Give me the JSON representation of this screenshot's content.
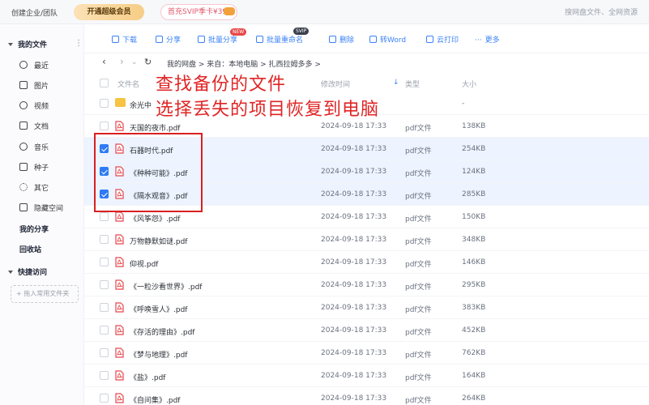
{
  "topbar": {
    "org": "创建企业/团队",
    "vip_button": "开通超级会员",
    "promo": "首充SVIP季卡¥39!",
    "search_placeholder": "搜网盘文件、全网资源"
  },
  "sidebar": {
    "my_files": "我的文件",
    "items": [
      {
        "label": "最近",
        "icon": "clock-icon"
      },
      {
        "label": "图片",
        "icon": "image-icon"
      },
      {
        "label": "视频",
        "icon": "video-icon"
      },
      {
        "label": "文档",
        "icon": "document-icon"
      },
      {
        "label": "音乐",
        "icon": "music-icon"
      },
      {
        "label": "种子",
        "icon": "bt-icon"
      },
      {
        "label": "其它",
        "icon": "more-icon"
      },
      {
        "label": "隐藏空间",
        "icon": "lock-icon"
      }
    ],
    "my_share": "我的分享",
    "recycle": "回收站",
    "quick_access": "快捷访问",
    "add_folder": "+ 拖入常用文件夹"
  },
  "toolbar": {
    "download": "下载",
    "share": "分享",
    "batch_share": "批量分享",
    "batch_share_badge": "NEW",
    "batch_rename": "批量重命名",
    "batch_rename_badge": "SVIP",
    "delete": "删除",
    "to_word": "转Word",
    "cloud_print": "云打印",
    "more": "更多"
  },
  "breadcrumb": {
    "path": "我的网盘  >  来自：本地电脑  >  扎西拉姆多多  >"
  },
  "columns": {
    "name": "文件名",
    "modified": "修改时间",
    "type": "类型",
    "size": "大小"
  },
  "annotations": {
    "line1": "查找备份的文件",
    "line2": "选择丢失的项目恢复到电脑"
  },
  "files": [
    {
      "name": "余光中",
      "date": "",
      "type": "",
      "size": "-",
      "kind": "folder",
      "checked": false
    },
    {
      "name": "天国的夜市.pdf",
      "date": "2024-09-18 17:33",
      "type": "pdf文件",
      "size": "138KB",
      "kind": "pdf",
      "checked": false
    },
    {
      "name": "石器时代.pdf",
      "date": "2024-09-18 17:33",
      "type": "pdf文件",
      "size": "254KB",
      "kind": "pdf",
      "checked": true
    },
    {
      "name": "《种种可能》.pdf",
      "date": "2024-09-18 17:33",
      "type": "pdf文件",
      "size": "124KB",
      "kind": "pdf",
      "checked": true
    },
    {
      "name": "《隔水观音》.pdf",
      "date": "2024-09-18 17:33",
      "type": "pdf文件",
      "size": "285KB",
      "kind": "pdf",
      "checked": true
    },
    {
      "name": "《风筝怨》.pdf",
      "date": "2024-09-18 17:33",
      "type": "pdf文件",
      "size": "150KB",
      "kind": "pdf",
      "checked": false
    },
    {
      "name": "万物静默如谜.pdf",
      "date": "2024-09-18 17:33",
      "type": "pdf文件",
      "size": "348KB",
      "kind": "pdf",
      "checked": false
    },
    {
      "name": "仰视.pdf",
      "date": "2024-09-18 17:33",
      "type": "pdf文件",
      "size": "146KB",
      "kind": "pdf",
      "checked": false
    },
    {
      "name": "《一粒沙看世界》.pdf",
      "date": "2024-09-18 17:33",
      "type": "pdf文件",
      "size": "295KB",
      "kind": "pdf",
      "checked": false
    },
    {
      "name": "《呼唤雪人》.pdf",
      "date": "2024-09-18 17:33",
      "type": "pdf文件",
      "size": "383KB",
      "kind": "pdf",
      "checked": false
    },
    {
      "name": "《存活的理由》.pdf",
      "date": "2024-09-18 17:33",
      "type": "pdf文件",
      "size": "452KB",
      "kind": "pdf",
      "checked": false
    },
    {
      "name": "《梦与地理》.pdf",
      "date": "2024-09-18 17:33",
      "type": "pdf文件",
      "size": "762KB",
      "kind": "pdf",
      "checked": false
    },
    {
      "name": "《盐》.pdf",
      "date": "2024-09-18 17:33",
      "type": "pdf文件",
      "size": "164KB",
      "kind": "pdf",
      "checked": false
    },
    {
      "name": "《自问集》.pdf",
      "date": "2024-09-18 17:33",
      "type": "pdf文件",
      "size": "264KB",
      "kind": "pdf",
      "checked": false
    }
  ],
  "colors": {
    "accent": "#3b82f6",
    "selected_row": "#edf4ff",
    "annotation": "#e02525",
    "pdf_icon": "#e5484d",
    "folder_icon": "#f6c343"
  }
}
